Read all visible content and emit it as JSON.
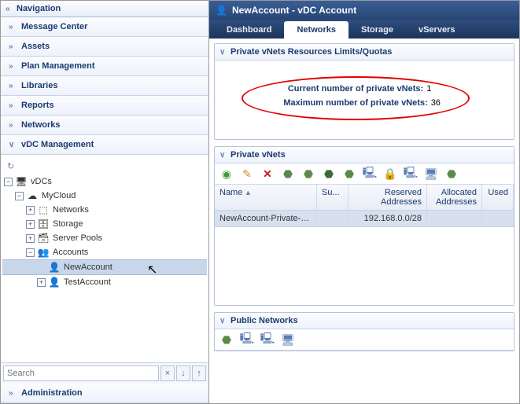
{
  "nav": {
    "title": "Navigation",
    "items": [
      "Message Center",
      "Assets",
      "Plan Management",
      "Libraries",
      "Reports",
      "Networks",
      "vDC Management"
    ],
    "admin": "Administration",
    "search_placeholder": "Search"
  },
  "tree": {
    "root": "vDCs",
    "cloud": "MyCloud",
    "nodes": [
      "Networks",
      "Storage",
      "Server Pools",
      "Accounts"
    ],
    "accounts": [
      "NewAccount",
      "TestAccount"
    ]
  },
  "header": {
    "title": "NewAccount - vDC Account",
    "tabs": [
      "Dashboard",
      "Networks",
      "Storage",
      "vServers"
    ],
    "active_tab": 1
  },
  "quotas": {
    "panel_title": "Private vNets Resources Limits/Quotas",
    "current_label": "Current number of private vNets:",
    "current_value": "1",
    "max_label": "Maximum number of private vNets:",
    "max_value": "36"
  },
  "private_vnets": {
    "panel_title": "Private vNets",
    "columns": [
      "Name",
      "Su...",
      "Reserved Addresses",
      "Allocated Addresses",
      "Used"
    ],
    "rows": [
      {
        "name": "NewAccount-Private-v...",
        "su": "",
        "reserved": "192.168.0.0/28",
        "alloc": "",
        "used": ""
      }
    ]
  },
  "public_nets": {
    "panel_title": "Public Networks"
  },
  "chart_data": {
    "type": "table",
    "title": "Private vNets Resources Limits/Quotas",
    "series": [
      {
        "name": "Current number of private vNets",
        "values": [
          1
        ]
      },
      {
        "name": "Maximum number of private vNets",
        "values": [
          36
        ]
      }
    ]
  }
}
